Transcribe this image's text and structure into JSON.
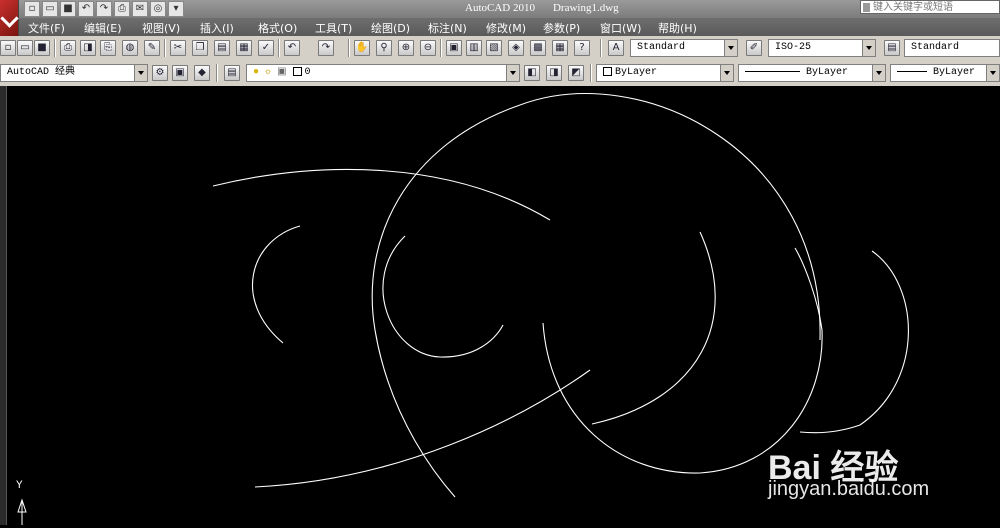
{
  "title_bar": {
    "app_name": "AutoCAD 2010",
    "document": "Drawing1.dwg",
    "search_placeholder": "键入关键字或短语"
  },
  "menu": [
    "文件(F)",
    "编辑(E)",
    "视图(V)",
    "插入(I)",
    "格式(O)",
    "工具(T)",
    "绘图(D)",
    "标注(N)",
    "修改(M)",
    "参数(P)",
    "窗口(W)",
    "帮助(H)"
  ],
  "styles_toolbar": {
    "text_style": "Standard",
    "dim_style": "ISO-25",
    "table_style": "Standard"
  },
  "workspace": "AutoCAD 经典",
  "layer": {
    "current": "0",
    "color": "ByLayer",
    "linetype": "ByLayer",
    "lineweight": "ByLayer"
  },
  "ucs": {
    "y_label": "Y"
  },
  "watermark": {
    "brand": "Bai 经验",
    "url": "jingyan.baidu.com"
  }
}
